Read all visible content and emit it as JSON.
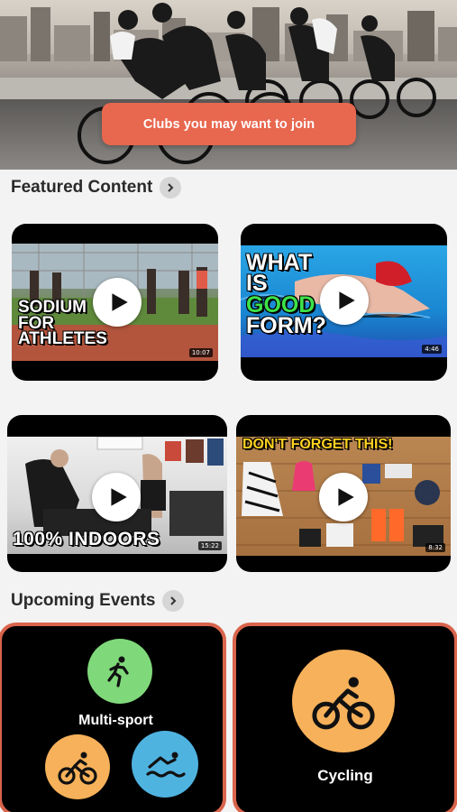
{
  "hero": {
    "button_label": "Clubs you may want to join"
  },
  "featured": {
    "title": "Featured Content",
    "videos": [
      {
        "overlay": "SODIUM\nFOR\nATHLETES",
        "line1": "SODIUM",
        "line2": "FOR",
        "line3": "ATHLETES",
        "duration": "10:07"
      },
      {
        "line1": "WHAT",
        "line2": "IS",
        "line3": "GOOD",
        "line4": "FORM?",
        "duration": "4:46"
      },
      {
        "line1": "100% INDOORS",
        "duration": "15:22"
      },
      {
        "line1": "DON'T FORGET THIS!",
        "duration": "8:32"
      }
    ]
  },
  "events": {
    "title": "Upcoming Events",
    "cards": [
      {
        "label": "Multi-sport",
        "icons": [
          "running-icon",
          "cycling-icon",
          "swimming-icon"
        ]
      },
      {
        "label": "Cycling",
        "icons": [
          "cycling-icon"
        ]
      }
    ]
  },
  "colors": {
    "accent": "#e8674f",
    "event_border": "#d9644c",
    "running_bg": "#7fd97a",
    "cycling_bg": "#f7b15a",
    "swimming_bg": "#4fb3e0",
    "good_green": "#3ee24a"
  }
}
